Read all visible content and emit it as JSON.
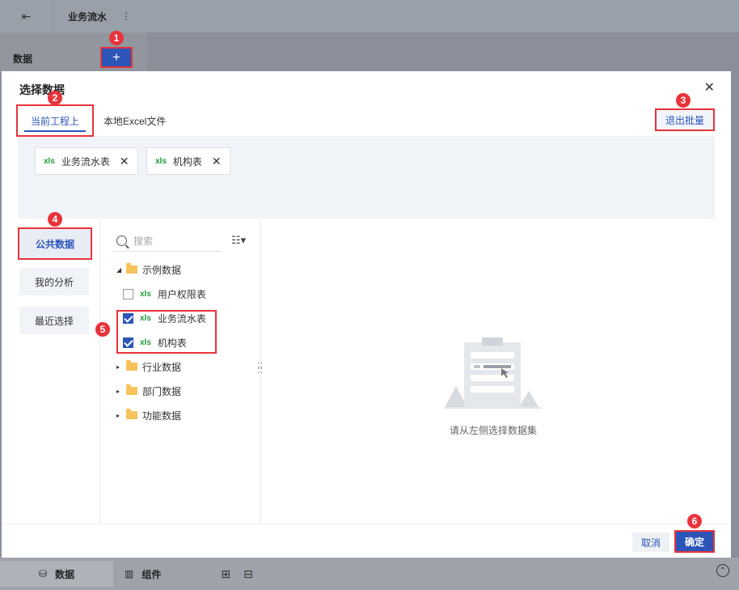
{
  "app": {
    "report_title": "业务流水",
    "data_panel_label": "数据"
  },
  "dialog": {
    "title": "选择数据",
    "tabs": [
      {
        "label": "当前工程上"
      },
      {
        "label": "本地Excel文件"
      }
    ],
    "exit_batch_label": "退出批量",
    "selected_chips": [
      {
        "type": "xls",
        "label": "业务流水表"
      },
      {
        "type": "xls",
        "label": "机构表"
      }
    ],
    "nav": [
      {
        "label": "公共数据"
      },
      {
        "label": "我的分析"
      },
      {
        "label": "最近选择"
      }
    ],
    "search_placeholder": "搜索",
    "tree": {
      "root": {
        "label": "示例数据"
      },
      "items": [
        {
          "type": "xls",
          "label": "用户权限表",
          "checked": false
        },
        {
          "type": "xls",
          "label": "业务流水表",
          "checked": true
        },
        {
          "type": "xls",
          "label": "机构表",
          "checked": true
        }
      ],
      "folders": [
        {
          "label": "行业数据"
        },
        {
          "label": "部门数据"
        },
        {
          "label": "功能数据"
        }
      ]
    },
    "empty_text": "请从左侧选择数据集",
    "cancel_label": "取消",
    "ok_label": "确定",
    "xls_tag": "xls"
  },
  "bottom_tabs": [
    {
      "label": "数据"
    },
    {
      "label": "组件"
    }
  ],
  "badges": [
    "1",
    "2",
    "3",
    "4",
    "5",
    "6"
  ],
  "colors": {
    "accent": "#2d55b8",
    "highlight_border": "#e8333b",
    "xls_green": "#1f9a3a",
    "folder": "#f5c35a"
  }
}
